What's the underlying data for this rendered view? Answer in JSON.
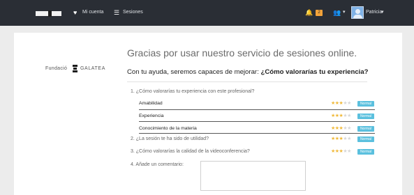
{
  "nav": {
    "mi_cuenta": "Mi cuenta",
    "sesiones": "Sesiones",
    "notifications_count": "2",
    "user_name": "Patricia",
    "user_caret": "▾",
    "group_caret": "▾",
    "icons": {
      "heart": "heart-icon",
      "list": "list-icon",
      "bell": "bell-icon",
      "users": "users-icon"
    }
  },
  "brand": {
    "prefix": "Fundació",
    "name": "GALATEA"
  },
  "header": {
    "title": "Gracias por usar nuestro servicio de sesiones online.",
    "subtitle_plain": "Con tu ayuda, seremos capaces de mejorar: ",
    "subtitle_bold": "¿Cómo valorarías tu experiencia?"
  },
  "survey": {
    "q1": "1. ¿Cómo valorarías tu experiencia con este profesional?",
    "q1_items": [
      {
        "label": "Amabilidad",
        "rating": 3,
        "badge": "Normal"
      },
      {
        "label": "Experiencia",
        "rating": 3,
        "badge": "Normal"
      },
      {
        "label": "Conocimiento de la materia",
        "rating": 3,
        "badge": "Normal"
      }
    ],
    "q2": {
      "label": "2. ¿La sesión te ha sido de utilidad?",
      "rating": 3,
      "badge": "Normal"
    },
    "q3": {
      "label": "3. ¿Cómo valorarías la calidad de la videoconferencia?",
      "rating": 3,
      "badge": "Normal"
    },
    "q4": "4. Añade un comentario:",
    "comment": ""
  },
  "colors": {
    "star_on": "#f0b93a",
    "star_off": "#d7d7d7",
    "badge": "#5bc0de",
    "topbar": "#2a2e35"
  }
}
